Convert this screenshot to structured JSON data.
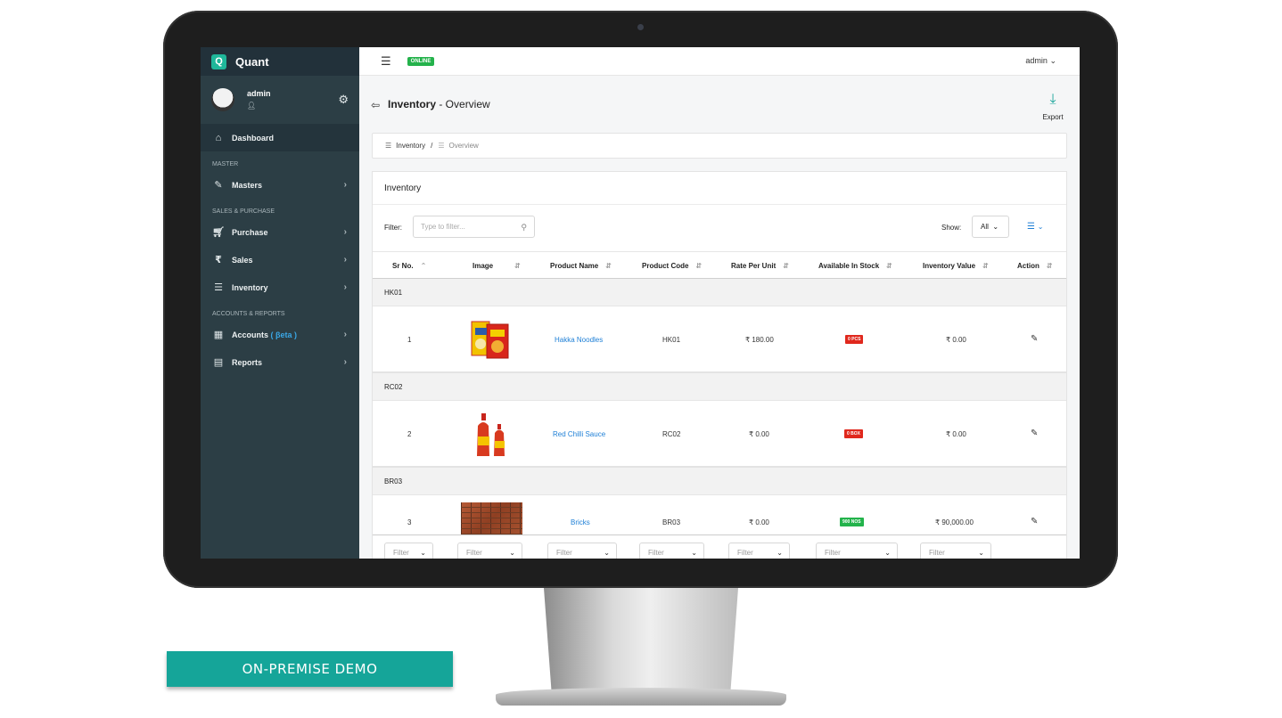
{
  "brand": {
    "logo_letter": "Q",
    "name": "Quant"
  },
  "user": {
    "name": "admin"
  },
  "sidebar": {
    "dashboard": "Dashboard",
    "section_master": "MASTER",
    "masters": "Masters",
    "section_sales": "SALES & PURCHASE",
    "purchase": "Purchase",
    "sales": "Sales",
    "inventory": "Inventory",
    "section_accounts": "ACCOUNTS & REPORTS",
    "accounts": "Accounts",
    "accounts_beta": "( βeta )",
    "reports": "Reports"
  },
  "topbar": {
    "status": "ONLINE",
    "user_menu": "admin"
  },
  "page": {
    "title_bold": "Inventory",
    "title_rest": " - Overview",
    "export_label": "Export"
  },
  "breadcrumb": {
    "item1": "Inventory",
    "separator": "/",
    "item2": "Overview"
  },
  "panel": {
    "title": "Inventory",
    "filter_label": "Filter:",
    "filter_placeholder": "Type to filter...",
    "show_label": "Show:",
    "show_value": "All"
  },
  "table": {
    "headers": [
      "Sr No.",
      "Image",
      "Product Name",
      "Product Code",
      "Rate Per Unit",
      "Available In Stock",
      "Inventory Value",
      "Action"
    ],
    "groups": [
      {
        "code": "HK01",
        "sr": "1",
        "name": "Hakka Noodles",
        "product_code": "HK01",
        "rate": "₹ 180.00",
        "stock": "0 PCS",
        "value": "₹ 0.00"
      },
      {
        "code": "RC02",
        "sr": "2",
        "name": "Red Chilli Sauce",
        "product_code": "RC02",
        "rate": "₹ 0.00",
        "stock": "0 BOX",
        "value": "₹ 0.00"
      },
      {
        "code": "BR03",
        "sr": "3",
        "name": "Bricks",
        "product_code": "BR03",
        "rate": "₹ 0.00",
        "stock": "900 NOS",
        "value": "₹ 90,000.00"
      }
    ],
    "footer_filter": "Filter"
  },
  "cta": {
    "label": "ON-PREMISE DEMO"
  },
  "colors": {
    "sidebar_bg": "#2c3e45",
    "accent": "#15a599",
    "link": "#1e7fd6",
    "stock_out": "#e0281d",
    "stock_in": "#23b34b"
  }
}
